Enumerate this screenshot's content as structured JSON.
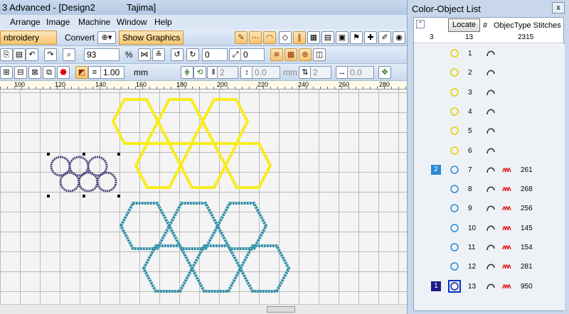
{
  "title": {
    "app": "3 Advanced - [Design2",
    "machine": "Tajima]"
  },
  "menu": [
    "Arrange",
    "Image",
    "Machine",
    "Window",
    "Help"
  ],
  "toolbar1": {
    "mode_button": "nbroidery Mode",
    "convert_button": "Convert",
    "show_graphics_button": "Show Graphics"
  },
  "toolbar2": {
    "zoom": "93",
    "zoom_unit": "%",
    "angle1": "0",
    "angle2": "0"
  },
  "toolbar3": {
    "size": "1.00",
    "size_unit": "mm",
    "f1": "2",
    "f2": "0.0",
    "f3": "2",
    "f4": "0.0",
    "unit": "mm"
  },
  "ruler": {
    "ticks": [
      "100",
      "120",
      "140",
      "160",
      "180",
      "200",
      "220",
      "240",
      "260",
      "280"
    ]
  },
  "panel": {
    "title": "Color-Object List",
    "close": "x",
    "locate": "Locate",
    "col_hash": "#",
    "col_type": "ObjecType Stitches",
    "count_colors": "3",
    "count_objects": "13",
    "total_stitches": "2315",
    "rows": [
      {
        "color": "",
        "num": "1",
        "stitches": ""
      },
      {
        "color": "",
        "num": "2",
        "stitches": ""
      },
      {
        "color": "",
        "num": "3",
        "stitches": ""
      },
      {
        "color": "",
        "num": "4",
        "stitches": ""
      },
      {
        "color": "",
        "num": "5",
        "stitches": ""
      },
      {
        "color": "",
        "num": "6",
        "stitches": ""
      },
      {
        "color": "2",
        "num": "7",
        "stitches": "261"
      },
      {
        "color": "",
        "num": "8",
        "stitches": "268"
      },
      {
        "color": "",
        "num": "9",
        "stitches": "256"
      },
      {
        "color": "",
        "num": "10",
        "stitches": "145"
      },
      {
        "color": "",
        "num": "11",
        "stitches": "154"
      },
      {
        "color": "",
        "num": "12",
        "stitches": "281"
      },
      {
        "color": "1",
        "num": "13",
        "stitches": "950"
      }
    ]
  },
  "colors": {
    "yellow": "#f8ec1f",
    "teal": "#2f8fa8",
    "purple": "#4b3a7a",
    "accent": "#f9c56f"
  }
}
